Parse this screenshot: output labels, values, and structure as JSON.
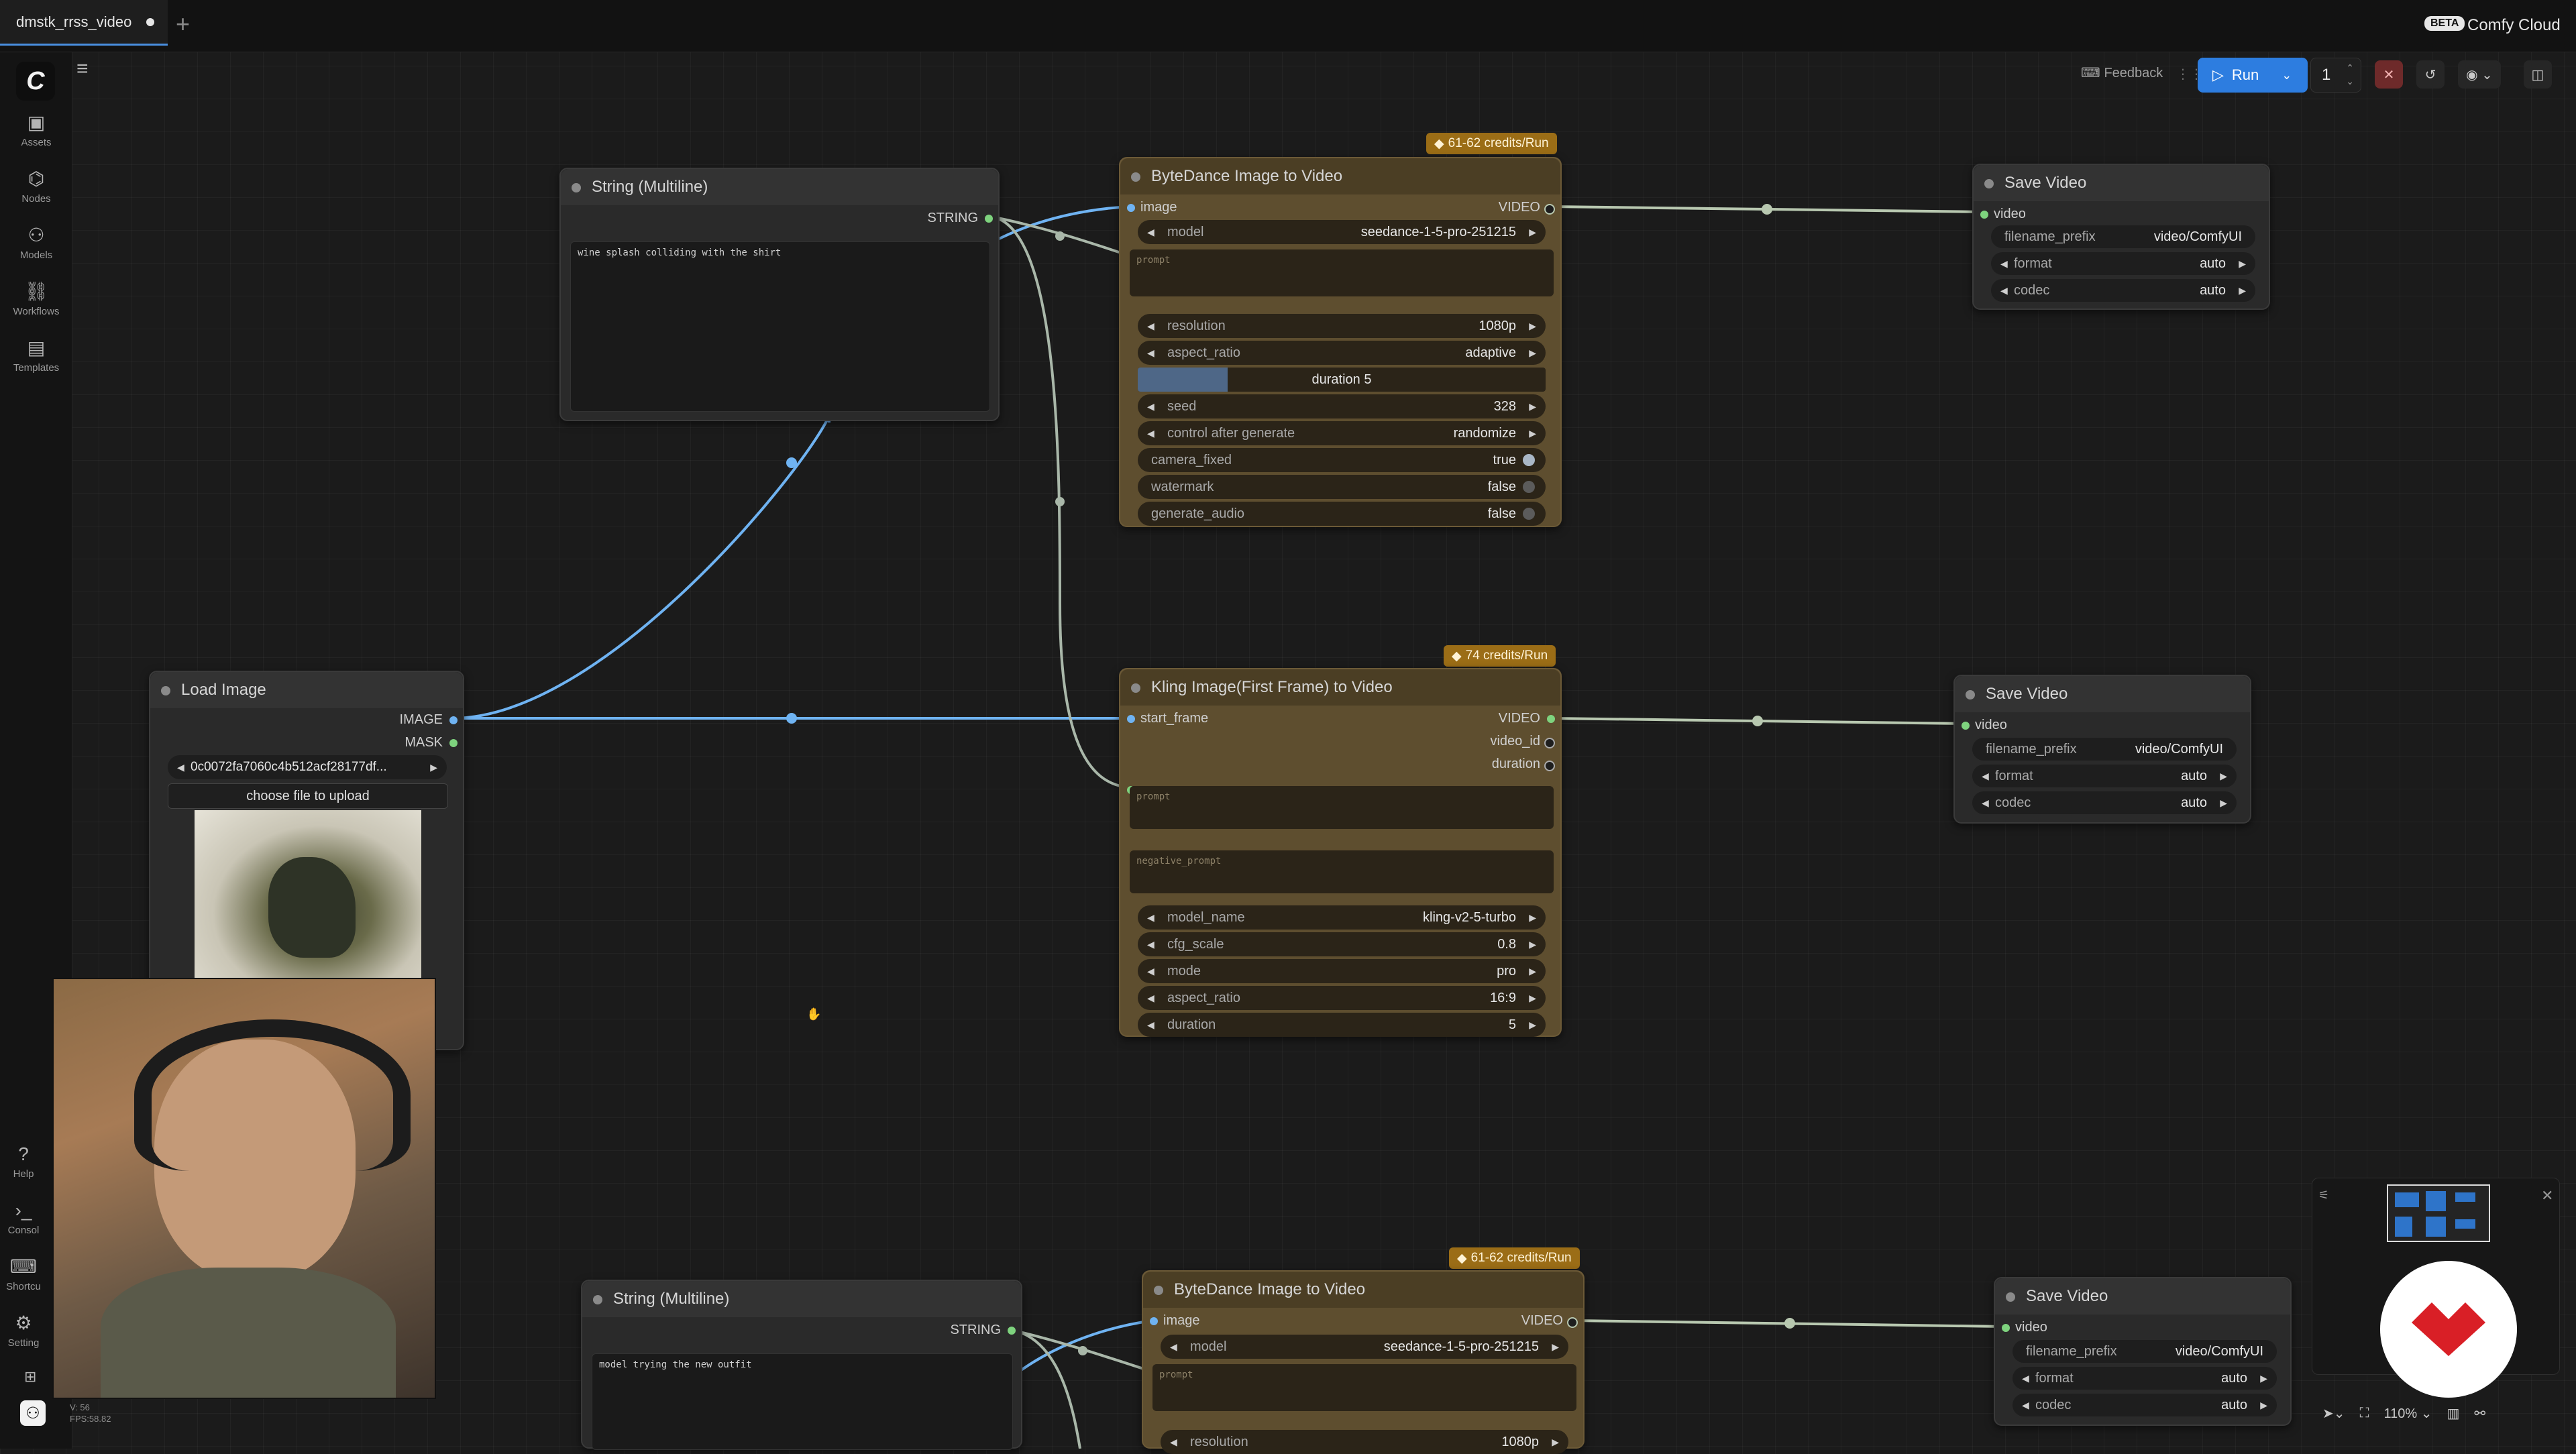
{
  "tab": {
    "title": "dmstk_rrss_video"
  },
  "header": {
    "beta": "BETA",
    "brand": "Comfy Cloud"
  },
  "toolbar": {
    "feedback": "Feedback",
    "run": "Run",
    "run_count": "1"
  },
  "sidebar": {
    "items": [
      {
        "label": "Assets",
        "icon": "assets-icon"
      },
      {
        "label": "Nodes",
        "icon": "nodes-icon"
      },
      {
        "label": "Models",
        "icon": "models-icon"
      },
      {
        "label": "Workflows",
        "icon": "workflows-icon"
      },
      {
        "label": "Templates",
        "icon": "templates-icon"
      }
    ],
    "bottom": [
      {
        "label": "Help"
      },
      {
        "label": "Consol"
      },
      {
        "label": "Shortcu"
      },
      {
        "label": "Setting"
      }
    ],
    "version": "V: 56",
    "fps": "FPS:58.82"
  },
  "nodes": {
    "string1": {
      "title": "String (Multiline)",
      "out": "STRING",
      "text": "wine splash colliding with the shirt"
    },
    "string2": {
      "title": "String (Multiline)",
      "out": "STRING",
      "text": "model trying the new outfit"
    },
    "load_image": {
      "title": "Load Image",
      "out1": "IMAGE",
      "out2": "MASK",
      "file": "0c0072fa7060c4b512acf28177df...",
      "upload": "choose file to upload"
    },
    "bytedance1": {
      "title": "ByteDance Image to Video",
      "credits": "61-62 credits/Run",
      "in": "image",
      "out": "VIDEO",
      "model_label": "model",
      "model": "seedance-1-5-pro-251215",
      "prompt_ph": "prompt",
      "resolution_label": "resolution",
      "resolution": "1080p",
      "aspect_label": "aspect_ratio",
      "aspect": "adaptive",
      "duration_label": "duration",
      "duration": "5",
      "duration_fill": 0.22,
      "seed_label": "seed",
      "seed": "328",
      "control_label": "control after generate",
      "control": "randomize",
      "camera_label": "camera_fixed",
      "camera": "true",
      "watermark_label": "watermark",
      "watermark": "false",
      "audio_label": "generate_audio",
      "audio": "false"
    },
    "kling": {
      "title": "Kling Image(First Frame) to Video",
      "credits": "74 credits/Run",
      "in": "start_frame",
      "out1": "VIDEO",
      "out2": "video_id",
      "out3": "duration",
      "prompt_ph": "prompt",
      "neg_ph": "negative_prompt",
      "model_label": "model_name",
      "model": "kling-v2-5-turbo",
      "cfg_label": "cfg_scale",
      "cfg": "0.8",
      "mode_label": "mode",
      "mode": "pro",
      "aspect_label": "aspect_ratio",
      "aspect": "16:9",
      "duration_label": "duration",
      "duration": "5"
    },
    "bytedance2": {
      "title": "ByteDance Image to Video",
      "credits": "61-62 credits/Run",
      "in": "image",
      "out": "VIDEO",
      "model_label": "model",
      "model": "seedance-1-5-pro-251215",
      "prompt_ph": "prompt",
      "resolution_label": "resolution",
      "resolution": "1080p"
    },
    "save1": {
      "title": "Save Video",
      "in": "video",
      "prefix_label": "filename_prefix",
      "prefix": "video/ComfyUI",
      "format_label": "format",
      "format": "auto",
      "codec_label": "codec",
      "codec": "auto"
    },
    "save2": {
      "title": "Save Video",
      "in": "video",
      "prefix_label": "filename_prefix",
      "prefix": "video/ComfyUI",
      "format_label": "format",
      "format": "auto",
      "codec_label": "codec",
      "codec": "auto"
    },
    "save3": {
      "title": "Save Video",
      "in": "video",
      "prefix_label": "filename_prefix",
      "prefix": "video/ComfyUI",
      "format_label": "format",
      "format": "auto",
      "codec_label": "codec",
      "codec": "auto"
    }
  },
  "canvas": {
    "zoom": "110%"
  },
  "colors": {
    "accent": "#2d7de0",
    "link_image": "#6fb3f2",
    "link_string": "#a9b7a9",
    "link_video": "#b8c8b0",
    "credits": "#9b6d16"
  }
}
